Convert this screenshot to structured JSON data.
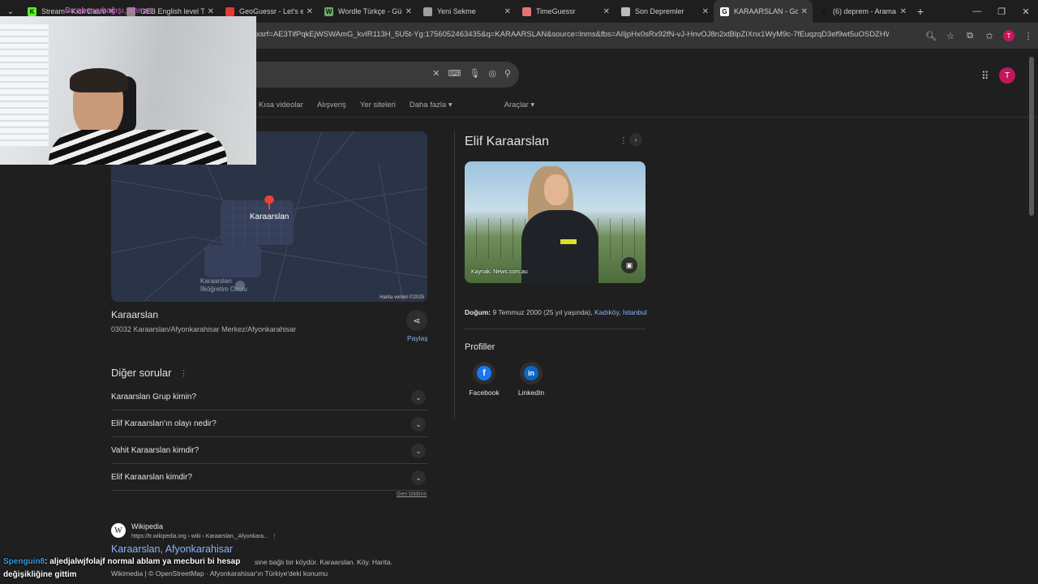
{
  "browser": {
    "tabs": [
      {
        "label": "Stream - Kick Dashb",
        "fav": "K",
        "color": "#53fc18"
      },
      {
        "label": "GEB English level Te",
        "fav": "",
        "color": "#888888"
      },
      {
        "label": "GeoGuessr - Let's exp",
        "fav": "",
        "color": "#e53935"
      },
      {
        "label": "Wordle Türkçe - Günl",
        "fav": "W",
        "color": "#6aaa64"
      },
      {
        "label": "Yeni Sekme",
        "fav": "",
        "color": "#9e9e9e"
      },
      {
        "label": "TimeGuessr",
        "fav": "",
        "color": "#e57373"
      },
      {
        "label": "Son Depremler",
        "fav": "",
        "color": "#bdbdbd"
      },
      {
        "label": "KARAARSLAN - Goo",
        "fav": "G",
        "color": "#ffffff",
        "active": true
      },
      {
        "label": "(6) deprem - Arama /",
        "fav": "X",
        "color": "#1e1e1e"
      }
    ],
    "url": "xsrf=AE3TifPqkEjWSWAmG_kvIR113H_5U5t-Yg:1756052463435&q=KARAARSLAN&source=lnms&fbs=AIIjpHx0sRx92fN-vJ-HnvOJ8n2xtBlpZIXnx1WyM9c-7fEuqzqD3ef9wt5uOSDZHWhG49N...",
    "profile_initial": "T"
  },
  "overlay": {
    "stream_text": "Bu abone bağışı, Ahmet"
  },
  "search": {
    "nav_tabs": [
      "Kısa videolar",
      "Alışveriş",
      "Yer siteleri",
      "Daha fazla ▾"
    ],
    "tools_label": "Araçlar ▾"
  },
  "map": {
    "place_label": "Karaarslan",
    "poi_line1": "Karaarslan",
    "poi_line2": "İlköğretim Okulu",
    "credit": "Harita verileri ©2025"
  },
  "place": {
    "title": "Karaarslan",
    "address": "03032 Karaarslan/Afyonkarahisar Merkez/Afyonkarahisar",
    "share_label": "Paylaş"
  },
  "paa": {
    "title": "Diğer sorular",
    "questions": [
      "Karaarslan Grup kimin?",
      "Elif Karaarslan'ın olayı nedir?",
      "Vahit Karaarslan kimdir?",
      "Elif Karaarslan kimdir?"
    ],
    "feedback": "Geri bildirim"
  },
  "result": {
    "site": "Wikipedia",
    "url": "https://tr.wikipedia.org › wiki › Karaarslan,_Afyonkara...",
    "title": "Karaarslan, Afyonkarahisar",
    "snippet": "sine bağlı bir köydür. Karaarslan. Köy. Harita.",
    "footer": "Wikimedia | © OpenStreetMap · Afyonkarahisar'ın Türkiye'deki konumu"
  },
  "chat": {
    "user": "Spenguin8",
    "message": ": aljedjalwjfolajf normal ablam ya mecburi bi hesap değişikliğine gittim"
  },
  "knowledge_panel": {
    "title": "Elif Karaarslan",
    "image_source": "Kaynak: News.com.au",
    "birth_label": "Doğum:",
    "birth_value": " 9 Temmuz 2000 (25 yıl yaşında), ",
    "birth_place1": "Kadıköy",
    "birth_sep": ", ",
    "birth_place2": "İstanbul",
    "profiles_title": "Profiller",
    "profiles": [
      {
        "label": "Facebook",
        "glyph": "f",
        "color": "#1877f2"
      },
      {
        "label": "LinkedIn",
        "glyph": "in",
        "color": "#0a66c2"
      }
    ]
  }
}
